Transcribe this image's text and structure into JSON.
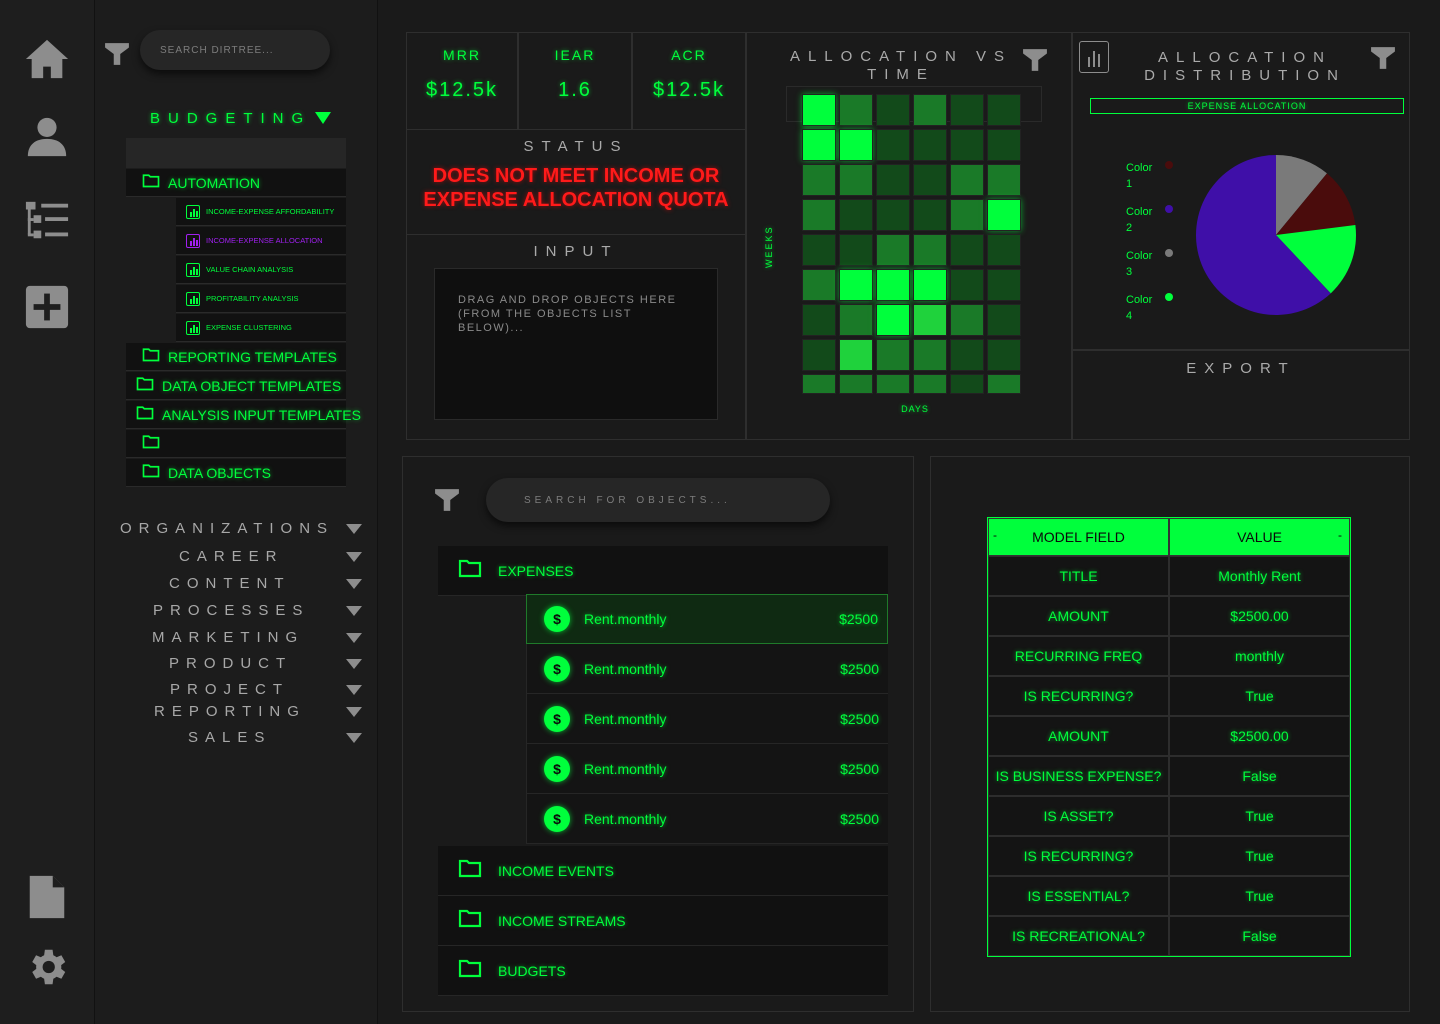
{
  "rail": {
    "icons": [
      "home-icon",
      "user-icon",
      "list-tree-icon",
      "add-icon",
      "document-icon",
      "settings-icon"
    ]
  },
  "sidebar": {
    "search_placeholder": "SEARCH DIRTREE...",
    "section_title": "BUDGETING",
    "folders": [
      {
        "label": "AUTOMATION"
      },
      {
        "label": "REPORTING TEMPLATES"
      },
      {
        "label": "DATA OBJECT TEMPLATES"
      },
      {
        "label": "ANALYSIS INPUT TEMPLATES"
      },
      {
        "label": ""
      },
      {
        "label": "DATA OBJECTS"
      }
    ],
    "automation_items": [
      {
        "label": "INCOME-EXPENSE AFFORDABILITY",
        "selected": false
      },
      {
        "label": "INCOME-EXPENSE ALLOCATION",
        "selected": true
      },
      {
        "label": "VALUE CHAIN ANALYSIS",
        "selected": false
      },
      {
        "label": "PROFITABILITY ANALYSIS",
        "selected": false
      },
      {
        "label": "EXPENSE CLUSTERING",
        "selected": false
      }
    ],
    "categories": [
      "ORGANIZATIONS",
      "CAREER",
      "CONTENT",
      "PROCESSES",
      "MARKETING",
      "PRODUCT",
      "PROJECT",
      "REPORTING",
      "SALES"
    ]
  },
  "kpis": [
    {
      "label": "MRR",
      "value": "$12.5k"
    },
    {
      "label": "IEAR",
      "value": "1.6"
    },
    {
      "label": "ACR",
      "value": "$12.5k"
    }
  ],
  "status": {
    "title": "STATUS",
    "message_line1": "DOES NOT MEET INCOME OR",
    "message_line2": "EXPENSE ALLOCATION QUOTA"
  },
  "input": {
    "title": "INPUT",
    "placeholder_line1": "DRAG AND DROP OBJECTS HERE",
    "placeholder_line2": "(FROM THE OBJECTS LIST",
    "placeholder_line3": "BELOW)..."
  },
  "heatmap": {
    "title_line1": "ALLOCATION VS",
    "title_line2": "TIME",
    "xlabel": "DAYS",
    "ylabel": "WEEKS",
    "levels": [
      [
        4,
        2,
        1,
        2,
        1,
        1
      ],
      [
        4,
        4,
        1,
        1,
        1,
        1
      ],
      [
        2,
        2,
        1,
        1,
        2,
        2
      ],
      [
        2,
        1,
        1,
        1,
        2,
        4
      ],
      [
        1,
        1,
        2,
        2,
        1,
        1
      ],
      [
        2,
        4,
        4,
        4,
        1,
        1
      ],
      [
        1,
        2,
        4,
        3,
        2,
        1
      ],
      [
        1,
        3,
        2,
        2,
        1,
        1
      ],
      [
        2,
        2,
        2,
        2,
        1,
        2
      ]
    ],
    "palette": [
      "#0e2a12",
      "#124a1a",
      "#1a7a28",
      "#1fd23c",
      "#00ff3c"
    ]
  },
  "pie": {
    "title_line1": "ALLOCATION",
    "title_line2": "DISTRIBUTION",
    "banner": "EXPENSE ALLOCATION",
    "export_label": "EXPORT",
    "legend": [
      {
        "label1": "Color",
        "label2": "1",
        "color": "#4a0c0c"
      },
      {
        "label1": "Color",
        "label2": "2",
        "color": "#3f0fa8"
      },
      {
        "label1": "Color",
        "label2": "3",
        "color": "#7a7a7a"
      },
      {
        "label1": "Color",
        "label2": "4",
        "color": "#00ff3c"
      }
    ]
  },
  "chart_data": {
    "type": "pie",
    "title": "ALLOCATION DISTRIBUTION",
    "slices": [
      {
        "name": "Color 1",
        "value": 12,
        "color": "#4a0c0c"
      },
      {
        "name": "Color 2",
        "value": 62,
        "color": "#3f0fa8"
      },
      {
        "name": "Color 3",
        "value": 11,
        "color": "#7a7a7a"
      },
      {
        "name": "Color 4",
        "value": 15,
        "color": "#00ff3c"
      }
    ]
  },
  "objects": {
    "search_placeholder": "SEARCH FOR OBJECTS...",
    "folders": [
      {
        "label": "EXPENSES"
      },
      {
        "label": "INCOME EVENTS"
      },
      {
        "label": "INCOME STREAMS"
      },
      {
        "label": "BUDGETS"
      }
    ],
    "expense_items": [
      {
        "name": "Rent.monthly",
        "amount": "$2500",
        "selected": true
      },
      {
        "name": "Rent.monthly",
        "amount": "$2500",
        "selected": false
      },
      {
        "name": "Rent.monthly",
        "amount": "$2500",
        "selected": false
      },
      {
        "name": "Rent.monthly",
        "amount": "$2500",
        "selected": false
      },
      {
        "name": "Rent.monthly",
        "amount": "$2500",
        "selected": false
      }
    ]
  },
  "model": {
    "headers": [
      "MODEL FIELD",
      "VALUE"
    ],
    "minus": "-",
    "rows": [
      {
        "field": "TITLE",
        "value": "Monthly Rent"
      },
      {
        "field": "AMOUNT",
        "value": "$2500.00"
      },
      {
        "field": "RECURRING FREQ",
        "value": "monthly"
      },
      {
        "field": "IS RECURRING?",
        "value": "True"
      },
      {
        "field": "AMOUNT",
        "value": "$2500.00"
      },
      {
        "field": "IS BUSINESS EXPENSE?",
        "value": "False"
      },
      {
        "field": "IS ASSET?",
        "value": "True"
      },
      {
        "field": "IS RECURRING?",
        "value": "True"
      },
      {
        "field": "IS ESSENTIAL?",
        "value": "True"
      },
      {
        "field": "IS RECREATIONAL?",
        "value": "False"
      }
    ]
  }
}
